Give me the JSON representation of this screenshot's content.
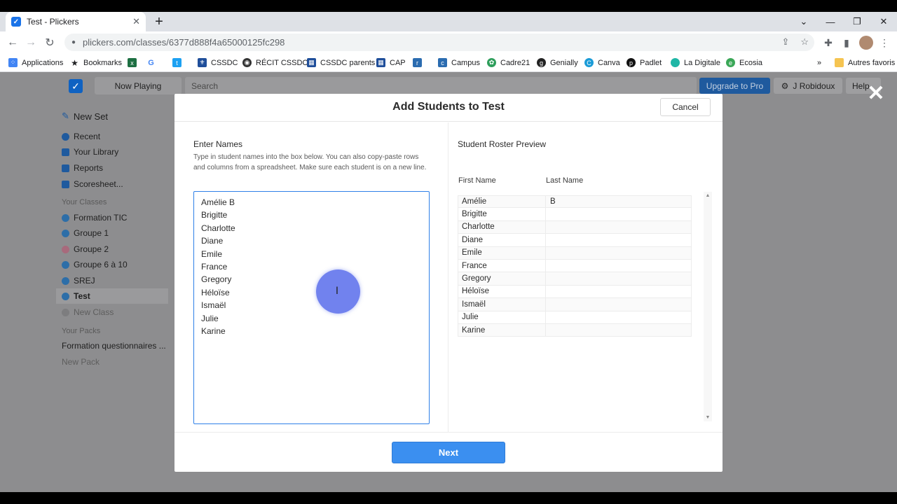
{
  "browser": {
    "tab_title": "Test - Plickers",
    "tab_favicon": "✓",
    "url": "plickers.com/classes/6377d888f4a65000125fc298",
    "bookmarks": [
      {
        "label": "Applications",
        "icon": "apps-grid-icon",
        "color": "#4285f4"
      },
      {
        "label": "Bookmarks",
        "icon": "star-icon",
        "color": "#202124"
      },
      {
        "label": "",
        "icon": "excel-icon",
        "color": "#1d6f42"
      },
      {
        "label": "",
        "icon": "google-icon",
        "color": "#4285f4"
      },
      {
        "label": "",
        "icon": "twitter-icon",
        "color": "#1da1f2"
      },
      {
        "label": "CSSDC",
        "icon": "cssdc-icon",
        "color": "#1f4e9a"
      },
      {
        "label": "RÉCIT CSSDC",
        "icon": "globe-icon",
        "color": "#333333"
      },
      {
        "label": "CSSDC parents",
        "icon": "cssdc-icon",
        "color": "#1f4e9a"
      },
      {
        "label": "CAP",
        "icon": "cap-icon",
        "color": "#1f4e9a"
      },
      {
        "label": "",
        "icon": "recit-icon",
        "color": "#2b6cb0"
      },
      {
        "label": "Campus",
        "icon": "campus-icon",
        "color": "#2b6cb0"
      },
      {
        "label": "Cadre21",
        "icon": "cadre21-icon",
        "color": "#2e9e5b"
      },
      {
        "label": "Genially",
        "icon": "genially-icon",
        "color": "#222222"
      },
      {
        "label": "Canva",
        "icon": "canva-icon",
        "color": "#1a9bd7"
      },
      {
        "label": "Padlet",
        "icon": "padlet-icon",
        "color": "#111111"
      },
      {
        "label": "La Digitale",
        "icon": "digitale-icon",
        "color": "#1fb6a6"
      },
      {
        "label": "Ecosia",
        "icon": "ecosia-icon",
        "color": "#3aa757"
      }
    ],
    "more_bookmarks": "»",
    "other_bookmarks": "Autres favoris"
  },
  "app": {
    "now_playing": "Now Playing",
    "search_placeholder": "Search",
    "upgrade": "Upgrade to Pro",
    "user": "J Robidoux",
    "help": "Help",
    "sidebar": {
      "new_set": "New Set",
      "recent": "Recent",
      "library": "Your Library",
      "reports": "Reports",
      "scoresheet": "Scoresheet...",
      "classes_header": "Your Classes",
      "classes": [
        {
          "label": "Formation TIC",
          "color": "#2d6ea8"
        },
        {
          "label": "Groupe 1",
          "color": "#2d6ea8"
        },
        {
          "label": "Groupe 2",
          "color": "#a86a7c"
        },
        {
          "label": "Groupe 6 à 10",
          "color": "#2d6ea8"
        },
        {
          "label": "SREJ",
          "color": "#2d6ea8"
        },
        {
          "label": "Test",
          "color": "#2d6ea8"
        }
      ],
      "new_class": "New Class",
      "packs_header": "Your Packs",
      "pack": "Formation questionnaires ...",
      "new_pack": "New Pack"
    }
  },
  "modal": {
    "title": "Add Students to Test",
    "cancel": "Cancel",
    "enter_names": "Enter Names",
    "help_text": "Type in student names into the box below. You can also copy-paste rows and columns from a spreadsheet. Make sure each student is on a new line.",
    "names": [
      "Amélie B",
      "Brigitte",
      "Charlotte",
      "Diane",
      "Emile",
      "France",
      "Gregory",
      "Héloïse",
      "Ismaël",
      "Julie",
      "Karine"
    ],
    "roster_title": "Student Roster Preview",
    "col_first": "First Name",
    "col_last": "Last Name",
    "roster": [
      {
        "first": "Amélie",
        "last": "B"
      },
      {
        "first": "Brigitte",
        "last": ""
      },
      {
        "first": "Charlotte",
        "last": ""
      },
      {
        "first": "Diane",
        "last": ""
      },
      {
        "first": "Emile",
        "last": ""
      },
      {
        "first": "France",
        "last": ""
      },
      {
        "first": "Gregory",
        "last": ""
      },
      {
        "first": "Héloïse",
        "last": ""
      },
      {
        "first": "Ismaël",
        "last": ""
      },
      {
        "first": "Julie",
        "last": ""
      },
      {
        "first": "Karine",
        "last": ""
      }
    ],
    "next": "Next"
  }
}
